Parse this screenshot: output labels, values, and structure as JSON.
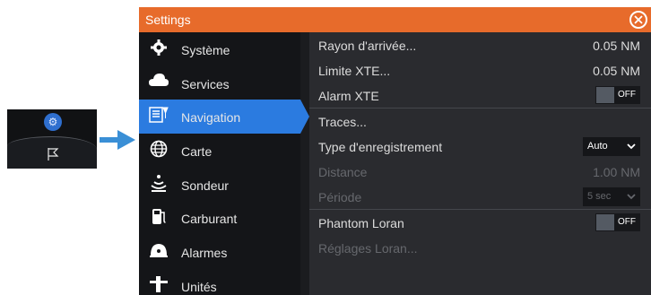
{
  "window": {
    "title": "Settings"
  },
  "sidebar": {
    "items": [
      {
        "label": "Système",
        "icon": "gear-icon"
      },
      {
        "label": "Services",
        "icon": "cloud-icon"
      },
      {
        "label": "Navigation",
        "icon": "navigation-icon",
        "active": true
      },
      {
        "label": "Carte",
        "icon": "globe-icon"
      },
      {
        "label": "Sondeur",
        "icon": "sonar-icon"
      },
      {
        "label": "Carburant",
        "icon": "fuel-pump-icon"
      },
      {
        "label": "Alarmes",
        "icon": "alarm-icon"
      },
      {
        "label": "Unités",
        "icon": "units-icon"
      }
    ]
  },
  "settings": {
    "arrival_radius": {
      "label": "Rayon d'arrivée...",
      "value": "0.05 NM"
    },
    "xte_limit": {
      "label": "Limite XTE...",
      "value": "0.05 NM"
    },
    "xte_alarm": {
      "label": "Alarm XTE",
      "toggle": "OFF"
    },
    "tracks": {
      "label": "Traces..."
    },
    "record_type": {
      "label": "Type d'enregistrement",
      "value": "Auto"
    },
    "distance": {
      "label": "Distance",
      "value": "1.00 NM"
    },
    "period": {
      "label": "Période",
      "value": "5 sec"
    },
    "phantom_loran": {
      "label": "Phantom Loran",
      "toggle": "OFF"
    },
    "loran_settings": {
      "label": "Réglages Loran..."
    }
  },
  "colors": {
    "titlebar": "#e76b2b",
    "active_item": "#2b7be0",
    "arrow": "#3a8fd6"
  }
}
